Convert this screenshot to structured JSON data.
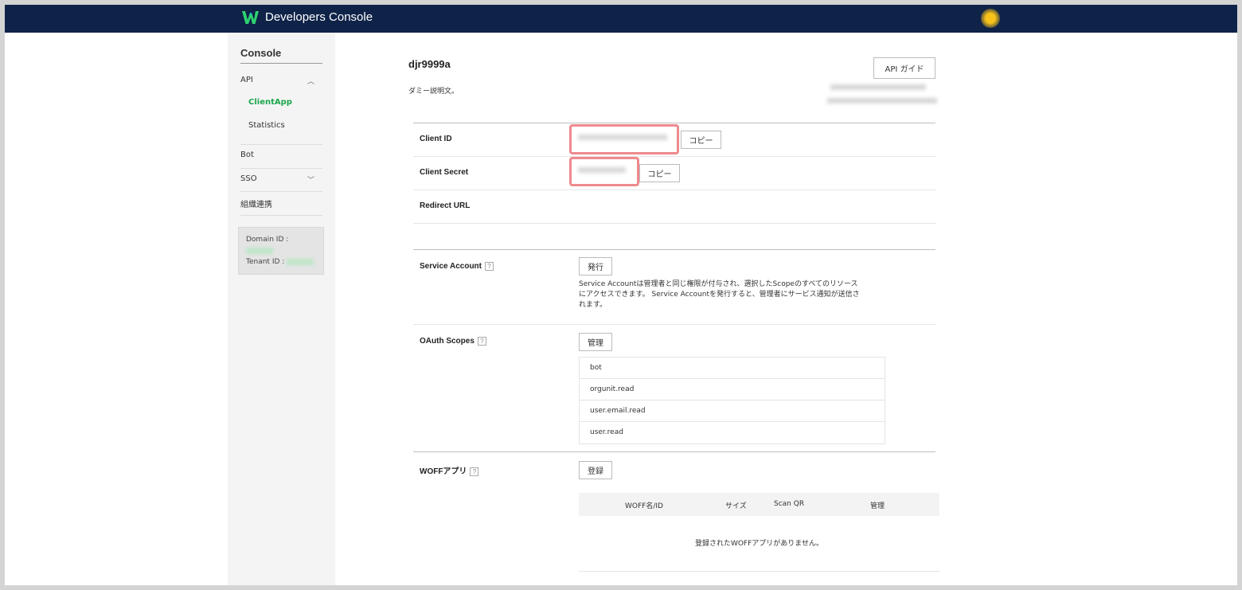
{
  "header": {
    "brand": "Developers Console"
  },
  "sidebar": {
    "title": "Console",
    "items": [
      {
        "label": "API",
        "expanded": true,
        "children": [
          {
            "label": "ClientApp",
            "active": true
          },
          {
            "label": "Statistics",
            "active": false
          }
        ]
      },
      {
        "label": "Bot"
      },
      {
        "label": "SSO",
        "expanded": false
      },
      {
        "label": "組織連携"
      }
    ],
    "domain_label": "Domain ID :",
    "tenant_label": "Tenant ID :"
  },
  "app": {
    "name": "djr9999a",
    "description": "ダミー説明文。",
    "api_guide_label": "API ガイド"
  },
  "credentials": {
    "client_id_label": "Client ID",
    "client_secret_label": "Client Secret",
    "redirect_url_label": "Redirect URL",
    "copy_label": "コピー"
  },
  "service_account": {
    "label": "Service Account",
    "issue_label": "発行",
    "description_lines": [
      "Service Accountは管理者と同じ権限が付与され、選択したScopeのすべてのリソース",
      "にアクセスできます。 Service Accountを発行すると、管理者にサービス通知が送信さ",
      "れます。"
    ]
  },
  "oauth": {
    "label": "OAuth Scopes",
    "manage_label": "管理",
    "scopes": [
      "bot",
      "orgunit.read",
      "user.email.read",
      "user.read"
    ]
  },
  "woff": {
    "label": "WOFFアプリ",
    "register_label": "登録",
    "columns": [
      "WOFF名/ID",
      "サイズ",
      "Scan QR",
      "管理"
    ],
    "empty_message": "登録されたWOFFアプリがありません。"
  },
  "colors": {
    "header_bg": "#0f2349",
    "accent_green": "#1ca64a",
    "mask_border": "#ee8a8e"
  },
  "icons": {
    "logo": "works-logo-icon",
    "help": "help-icon",
    "chevron_up": "chevron-up-icon",
    "chevron_down": "chevron-down-icon"
  }
}
